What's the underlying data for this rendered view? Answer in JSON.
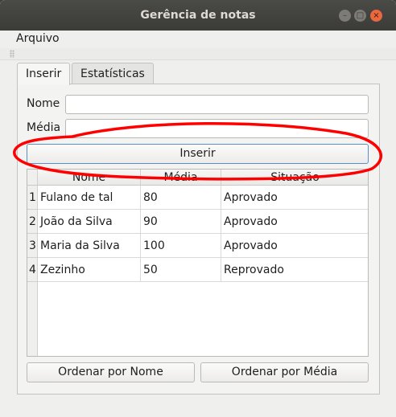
{
  "window": {
    "title": "Gerência de notas"
  },
  "menu": {
    "items": [
      "Arquivo"
    ]
  },
  "tabs": [
    {
      "label": "Inserir",
      "active": true
    },
    {
      "label": "Estatísticas",
      "active": false
    }
  ],
  "form": {
    "nome_label": "Nome",
    "nome_value": "",
    "media_label": "Média",
    "media_value": "",
    "submit_label": "Inserir"
  },
  "table": {
    "columns": [
      "Nome",
      "Média",
      "Situação"
    ],
    "rows": [
      {
        "num": "1",
        "nome": "Fulano de tal",
        "media": "80",
        "situacao": "Aprovado"
      },
      {
        "num": "2",
        "nome": "João da Silva",
        "media": "90",
        "situacao": "Aprovado"
      },
      {
        "num": "3",
        "nome": "Maria da Silva",
        "media": "100",
        "situacao": "Aprovado"
      },
      {
        "num": "4",
        "nome": "Zezinho",
        "media": "50",
        "situacao": "Reprovado"
      }
    ]
  },
  "sort_buttons": {
    "by_name": "Ordenar por Nome",
    "by_media": "Ordenar por Média"
  },
  "colors": {
    "annotation": "#ff0000",
    "focus_border": "#5b8fc7",
    "close_button": "#e9683f"
  }
}
